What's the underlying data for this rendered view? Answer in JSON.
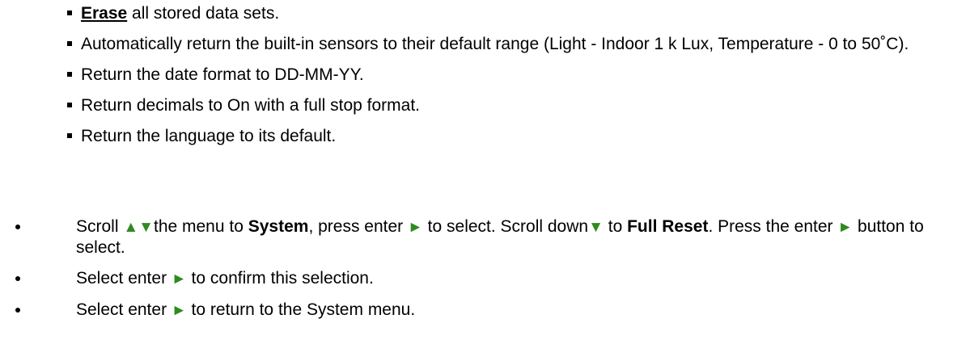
{
  "sub_items": [
    {
      "bold_underlined": "Erase",
      "rest": " all stored data sets."
    },
    {
      "text": "Automatically return the built-in sensors to their default range (Light - Indoor 1 k Lux, Temperature - 0 to 50˚C)."
    },
    {
      "text": "Return the date format to DD-MM-YY."
    },
    {
      "text": "Return decimals to On with a full stop format."
    },
    {
      "text": "Return the language to its default."
    }
  ],
  "main_items": [
    {
      "t1": "Scroll ",
      "icon_up": "▲",
      "icon_down": "▼",
      "t2": "the menu to ",
      "b1": "System",
      "t3": ", press enter ",
      "icon_right": "►",
      "t4": " to select. Scroll down",
      "icon_down2": "▼",
      "t5": " to ",
      "b2": "Full Reset",
      "t6": ". Press the enter ",
      "icon_right2": "►",
      "t7": " button to select."
    },
    {
      "t1": "Select enter ",
      "icon_right": "►",
      "t2": " to confirm this selection."
    },
    {
      "t1": "Select enter ",
      "icon_right": "►",
      "t2": " to return to the System menu."
    }
  ],
  "colors": {
    "arrow_icons": "#2e8b1e"
  },
  "icons": {
    "up": "up-arrow-icon",
    "down": "down-arrow-icon",
    "enter": "enter-arrow-icon"
  }
}
